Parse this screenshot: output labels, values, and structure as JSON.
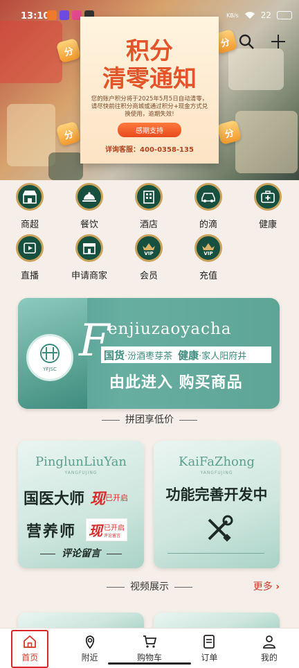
{
  "status_bar": {
    "time": "13:10",
    "net_speed": "KB/s",
    "battery": "22"
  },
  "hero": {
    "title_line1": "积分",
    "title_line2": "清零通知",
    "notice": "您的账户积分将于2025年5月5日自动清零，请尽快前往积分商城或通过积分+现金方式兑换使用，逾期失效!",
    "button": "感期支持",
    "phone": "详询客服：400-0358-135",
    "coin_char": "分"
  },
  "categories": [
    {
      "label": "商超",
      "icon": "store-icon"
    },
    {
      "label": "餐饮",
      "icon": "dish-cloche-icon"
    },
    {
      "label": "酒店",
      "icon": "hotel-icon"
    },
    {
      "label": "的滴",
      "icon": "car-icon"
    },
    {
      "label": "健康",
      "icon": "medical-kit-icon"
    },
    {
      "label": "直播",
      "icon": "live-video-icon"
    },
    {
      "label": "申请商家",
      "icon": "merchant-shop-icon"
    },
    {
      "label": "会员",
      "icon": "vip-crown-icon"
    },
    {
      "label": "充值",
      "icon": "vip-crown-icon"
    }
  ],
  "banner": {
    "heading_letter": "F",
    "heading_rest": "enjiuzaoyacha",
    "tagline_a": "国货",
    "tagline_b": "·汾酒枣芽茶",
    "tagline_c": "健康",
    "tagline_d": "·家人阳府井",
    "cta": "由此进入 购买商品",
    "logo_text": "YFJSC"
  },
  "section_group": {
    "title": "拼团享低价"
  },
  "cards": [
    {
      "script": "PinglunLiuYan",
      "sub": "YANGFUJING",
      "line1": "国医大师",
      "line2": "营养师",
      "badge_main": "现",
      "badge_side": "已开启",
      "badge_small": "评论留言",
      "footer": "评论留言"
    },
    {
      "script": "KaiFaZhong",
      "sub": "YANGFUJING",
      "line1": "功能完善开发中"
    }
  ],
  "section_video": {
    "title": "视频展示",
    "more": "更多"
  },
  "tabbar": [
    {
      "label": "首页",
      "icon": "home-icon"
    },
    {
      "label": "附近",
      "icon": "location-pin-icon"
    },
    {
      "label": "购物车",
      "icon": "cart-icon"
    },
    {
      "label": "订单",
      "icon": "order-list-icon"
    },
    {
      "label": "我的",
      "icon": "user-icon"
    }
  ],
  "colors": {
    "brand_red": "#d03a2a",
    "brand_green": "#17503e",
    "gold": "#c9a35c",
    "teal": "#5ea596"
  }
}
